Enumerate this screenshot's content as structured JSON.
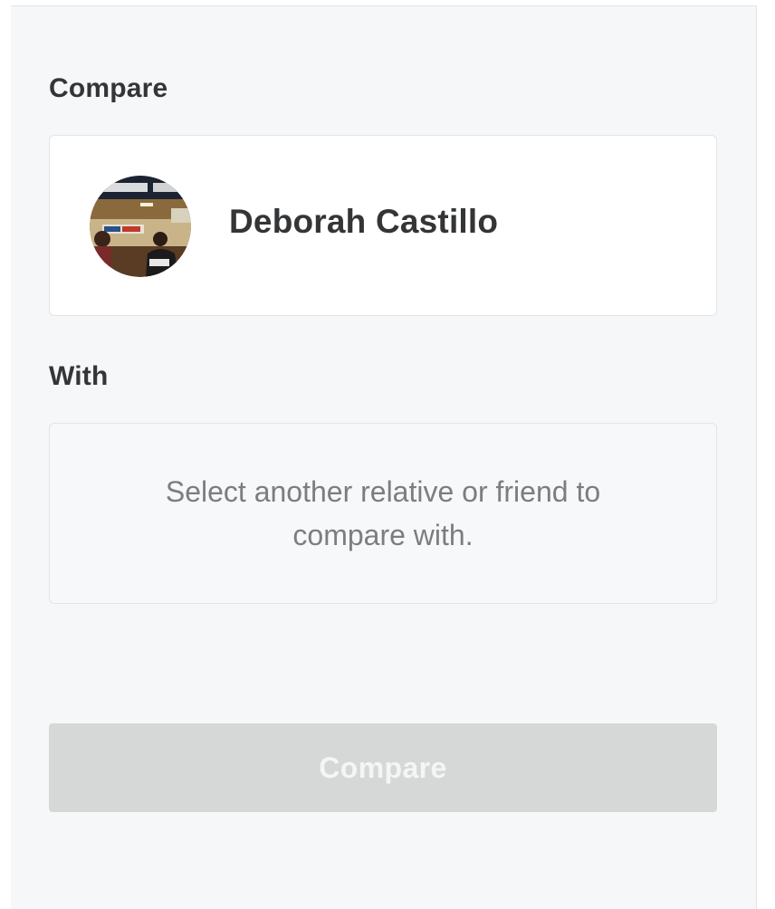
{
  "compare_section": {
    "label": "Compare",
    "selected_person": {
      "name": "Deborah Castillo",
      "avatar_icon": "person-photo-avatar"
    }
  },
  "with_section": {
    "label": "With",
    "placeholder": "Select another relative or friend to compare with."
  },
  "actions": {
    "compare_button_label": "Compare",
    "compare_button_state": "disabled"
  },
  "colors": {
    "panel_background": "#f6f7f9",
    "card_background": "#ffffff",
    "text_primary": "#333536",
    "text_muted": "#7b7e80",
    "button_disabled_background": "#d6d8d8",
    "button_disabled_text": "#f4f5f5"
  }
}
